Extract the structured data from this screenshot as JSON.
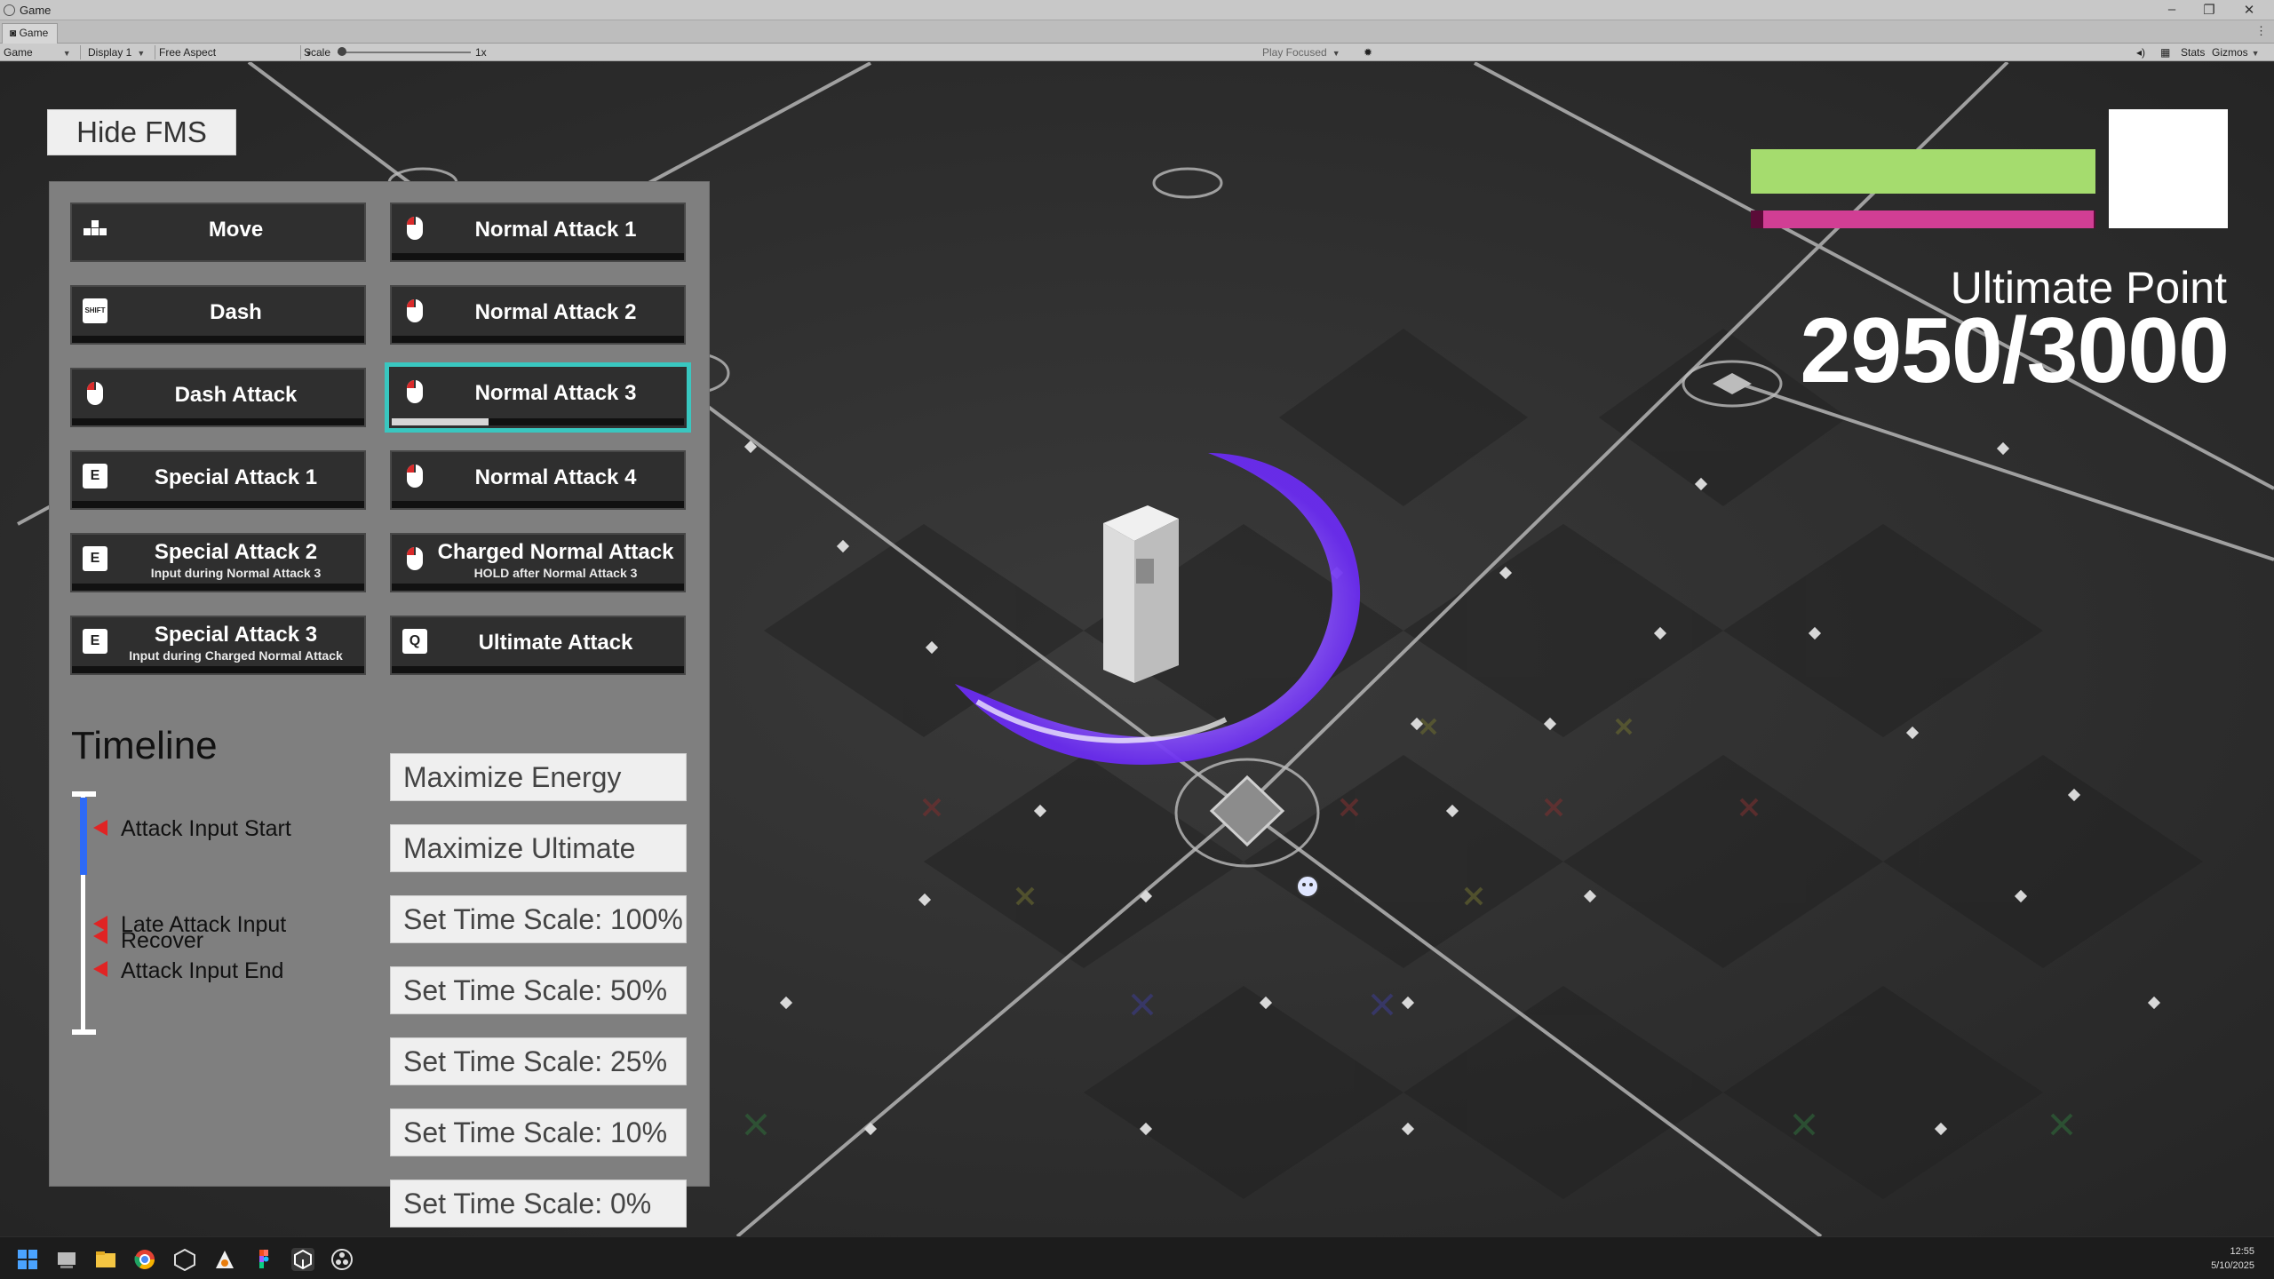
{
  "window": {
    "title": "Game"
  },
  "tabs": {
    "game_tab": "Game"
  },
  "toolbar": {
    "view": "Game",
    "display": "Display 1",
    "aspect": "Free Aspect",
    "scale_label": "Scale",
    "scale_value": "1x",
    "play_mode": "Play Focused",
    "stats": "Stats",
    "gizmos": "Gizmos"
  },
  "hud": {
    "hide_button": "Hide FMS",
    "ultimate_title": "Ultimate Point",
    "ultimate_value": "2950/3000",
    "ultimate_current": 2950,
    "ultimate_max": 3000,
    "hp_fraction": 1.0,
    "energy_fraction": 0.96,
    "colors": {
      "hp": "#a5dc6e",
      "energy": "#d13e94",
      "selected_outline": "#39c7c0"
    }
  },
  "actions": {
    "move": {
      "label": "Move",
      "icon": "move-icon"
    },
    "dash": {
      "label": "Dash",
      "key": "SHIFT"
    },
    "dash_attack": {
      "label": "Dash Attack",
      "icon": "mouse-left-icon"
    },
    "special_1": {
      "label": "Special Attack 1",
      "key": "E"
    },
    "special_2": {
      "label": "Special Attack 2",
      "sub": "Input during Normal Attack 3",
      "key": "E"
    },
    "special_3": {
      "label": "Special Attack 3",
      "sub": "Input during Charged Normal Attack",
      "key": "E"
    },
    "normal_1": {
      "label": "Normal Attack 1",
      "icon": "mouse-left-icon"
    },
    "normal_2": {
      "label": "Normal Attack 2",
      "icon": "mouse-left-icon"
    },
    "normal_3": {
      "label": "Normal Attack 3",
      "icon": "mouse-left-icon",
      "progress": 0.33
    },
    "normal_4": {
      "label": "Normal Attack 4",
      "icon": "mouse-left-icon"
    },
    "charged": {
      "label": "Charged Normal Attack",
      "sub": "HOLD after Normal Attack 3",
      "icon": "mouse-left-icon"
    },
    "ultimate": {
      "label": "Ultimate Attack",
      "key": "Q"
    }
  },
  "utility": {
    "max_energy": "Maximize Energy",
    "max_ultimate": "Maximize Ultimate",
    "ts_100": "Set Time Scale: 100%",
    "ts_50": "Set Time Scale: 50%",
    "ts_25": "Set Time Scale: 25%",
    "ts_10": "Set Time Scale: 10%",
    "ts_0": "Set Time Scale: 0%"
  },
  "timeline": {
    "title": "Timeline",
    "attack_input_start": "Attack Input Start",
    "late_attack_input": "Late Attack Input",
    "recover": "Recover",
    "attack_input_end": "Attack Input End"
  },
  "taskbar": {
    "time": "12:55",
    "date": "5/10/2025"
  }
}
